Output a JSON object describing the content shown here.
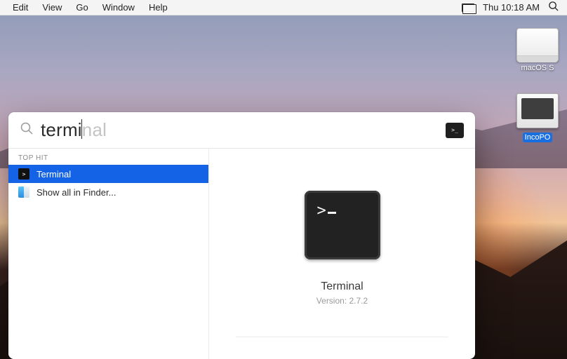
{
  "menubar": {
    "items": [
      "Edit",
      "View",
      "Go",
      "Window",
      "Help"
    ],
    "clock": "Thu 10:18 AM"
  },
  "desktop": {
    "drive1_label": "macOS S",
    "drive2_label": "IncoPO"
  },
  "spotlight": {
    "typed": "termi",
    "ghost": "nal",
    "section_top_hit": "TOP HIT",
    "results": [
      {
        "label": "Terminal",
        "icon": "terminal",
        "selected": true
      },
      {
        "label": "Show all in Finder...",
        "icon": "finder",
        "selected": false
      }
    ],
    "preview": {
      "title": "Terminal",
      "version_label": "Version: 2.7.2"
    }
  }
}
